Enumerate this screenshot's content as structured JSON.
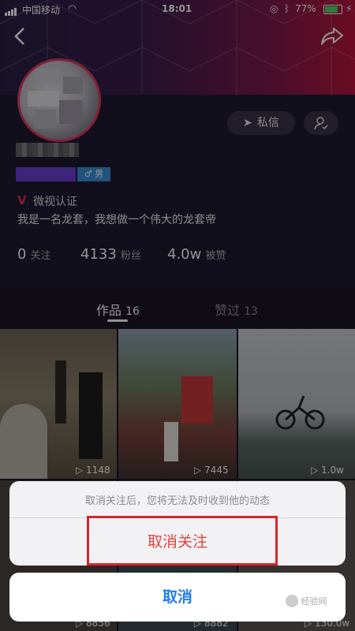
{
  "status_bar": {
    "carrier": "中国移动",
    "time": "18:01",
    "battery": "77%"
  },
  "profile": {
    "dm_button": "私信",
    "gender_tag": "♂ 男",
    "verify_label": "微视认证",
    "bio": "我是一名龙套，我想做一个伟大的龙套帝",
    "stats": [
      {
        "value": "0",
        "label": "关注"
      },
      {
        "value": "4133",
        "label": "粉丝"
      },
      {
        "value": "4.0w",
        "label": "被赞"
      }
    ]
  },
  "tabs": [
    {
      "label": "作品",
      "count": "16"
    },
    {
      "label": "赞过",
      "count": "13"
    }
  ],
  "videos": [
    {
      "plays": "1148"
    },
    {
      "plays": "7445"
    },
    {
      "plays": "1.0w"
    },
    {
      "plays": "8856"
    },
    {
      "plays": "8882"
    },
    {
      "plays": "130.0w"
    }
  ],
  "action_sheet": {
    "message": "取消关注后，您将无法及时收到他的动态",
    "confirm_label": "取消关注",
    "cancel_label": "取消"
  },
  "watermark": "经验网"
}
